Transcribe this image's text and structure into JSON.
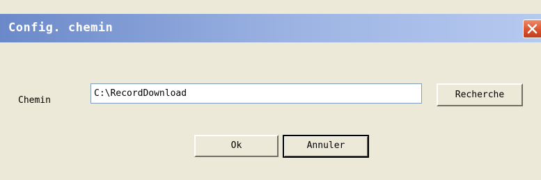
{
  "window": {
    "title": "Config. chemin",
    "close_icon": "close-icon"
  },
  "form": {
    "path_label": "Chemin",
    "path_value": "C:\\RecordDownload",
    "browse_label": "Recherche"
  },
  "actions": {
    "ok_label": "Ok",
    "cancel_label": "Annuler"
  },
  "colors": {
    "titlebar_start": "#6b89c9",
    "titlebar_end": "#b6c9ef",
    "dialog_background": "#ece9d8",
    "close_button": "#d9542f"
  }
}
